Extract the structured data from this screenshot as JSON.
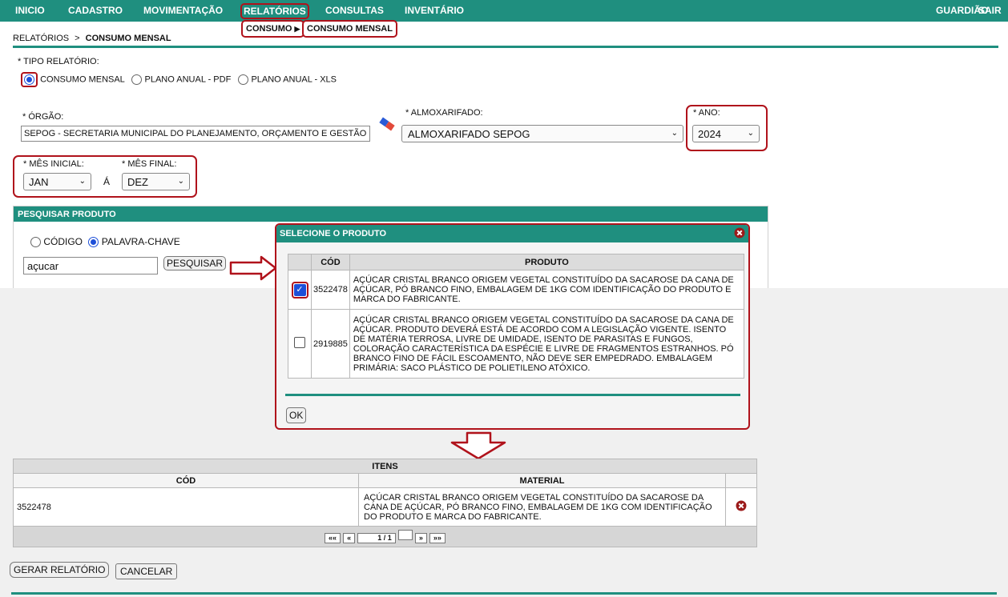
{
  "nav": {
    "items": [
      "INICIO",
      "CADASTRO",
      "MOVIMENTAÇÃO",
      "RELATÓRIOS",
      "CONSULTAS",
      "INVENTÁRIO"
    ],
    "user": "GUARDIÃO",
    "logout": "SAIR",
    "submenu": {
      "level1": "CONSUMO",
      "level2": "CONSUMO MENSAL"
    }
  },
  "breadcrumb": {
    "parent": "RELATÓRIOS",
    "sep": ">",
    "current": "CONSUMO MENSAL"
  },
  "report_type": {
    "label": "* TIPO RELATÓRIO:",
    "options": [
      "CONSUMO MENSAL",
      "PLANO ANUAL - PDF",
      "PLANO ANUAL - XLS"
    ],
    "selected": "CONSUMO MENSAL"
  },
  "orgao": {
    "label": "* ÓRGÃO:",
    "value": "SEPOG - SECRETARIA MUNICIPAL DO PLANEJAMENTO, ORÇAMENTO E GESTÃO"
  },
  "almoxarifado": {
    "label": "* ALMOXARIFADO:",
    "value": "ALMOXARIFADO SEPOG"
  },
  "ano": {
    "label": "* ANO:",
    "value": "2024"
  },
  "mes_inicial": {
    "label": "* MÊS INICIAL:",
    "value": "JAN"
  },
  "mes_sep": "Á",
  "mes_final": {
    "label": "* MÊS FINAL:",
    "value": "DEZ"
  },
  "search": {
    "title": "PESQUISAR PRODUTO",
    "options": [
      "CÓDIGO",
      "PALAVRA-CHAVE"
    ],
    "selected": "PALAVRA-CHAVE",
    "value": "açucar",
    "button": "PESQUISAR"
  },
  "modal": {
    "title": "SELECIONE O PRODUTO",
    "col_code": "CÓD",
    "col_product": "PRODUTO",
    "rows": [
      {
        "checked": true,
        "code": "3522478",
        "product": "AÇÚCAR CRISTAL BRANCO ORIGEM VEGETAL CONSTITUÍDO DA SACAROSE DA CANA DE AÇÚCAR, PÓ BRANCO FINO, EMBALAGEM DE 1KG COM IDENTIFICAÇÃO DO PRODUTO E MARCA DO FABRICANTE."
      },
      {
        "checked": false,
        "code": "2919885",
        "product": "AÇÚCAR CRISTAL BRANCO ORIGEM VEGETAL CONSTITUÍDO DA SACAROSE DA CANA DE AÇÚCAR. PRODUTO DEVERÁ ESTÁ DE ACORDO COM A LEGISLAÇÃO VIGENTE. ISENTO DE MATÉRIA TERROSA, LIVRE DE UMIDADE, ISENTO DE PARASITAS E FUNGOS, COLORAÇÃO CARACTERÍSTICA DA ESPÉCIE E LIVRE DE FRAGMENTOS ESTRANHOS. PÓ BRANCO FINO DE FÁCIL ESCOAMENTO, NÃO DEVE SER EMPEDRADO. EMBALAGEM PRIMÁRIA: SACO PLÁSTICO DE POLIETILENO ATÓXICO."
      }
    ],
    "ok": "OK"
  },
  "items": {
    "title": "ITENS",
    "col_code": "CÓD",
    "col_material": "MATERIAL",
    "rows": [
      {
        "code": "3522478",
        "material": "AÇÚCAR CRISTAL BRANCO ORIGEM VEGETAL CONSTITUÍDO DA SACAROSE DA CANA DE AÇÚCAR, PÓ BRANCO FINO, EMBALAGEM DE 1KG COM IDENTIFICAÇÃO DO PRODUTO E MARCA DO FABRICANTE."
      }
    ],
    "pager": {
      "first": "««",
      "prev": "«",
      "page": "1 / 1",
      "next": "»",
      "last": "»»"
    }
  },
  "actions": {
    "generate": "GERAR RELATÓRIO",
    "cancel": "CANCELAR"
  },
  "colors": {
    "teal": "#1f8f7f",
    "annotation": "#b0121b",
    "radio": "#1d4fd8"
  },
  "icons": [
    "eraser-icon",
    "close-icon",
    "remove-icon",
    "arrow-right-icon",
    "arrow-down-icon"
  ]
}
